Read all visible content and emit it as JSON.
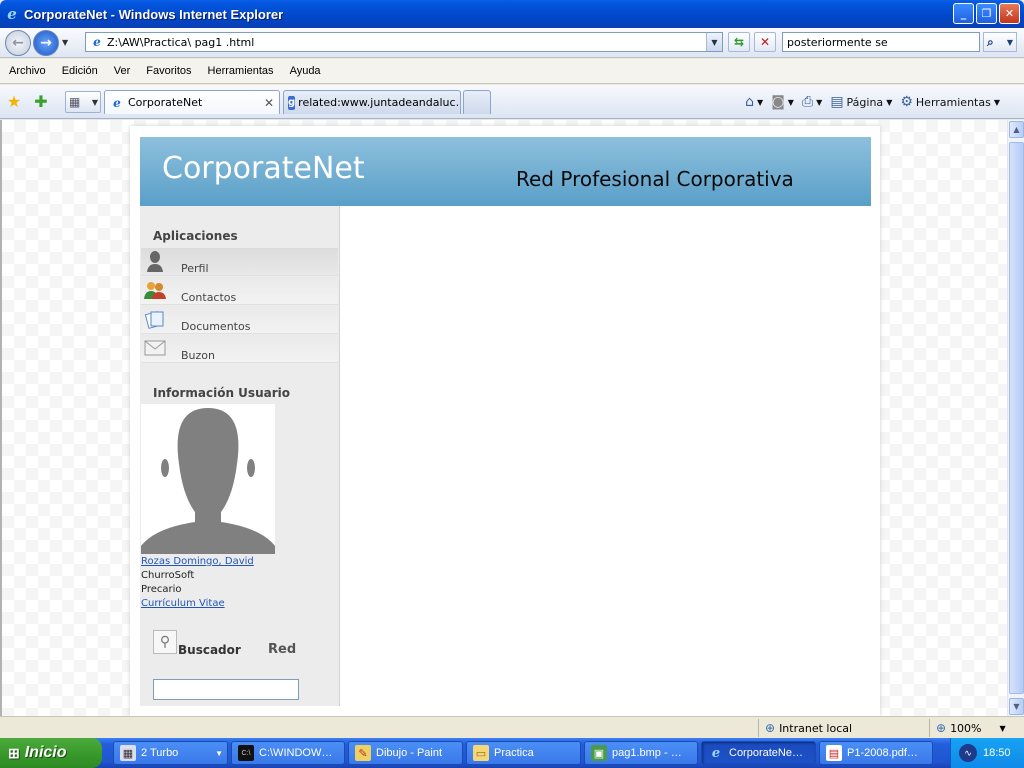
{
  "window": {
    "title": "CorporateNet - Windows Internet Explorer",
    "app_icon": "ie-logo-icon"
  },
  "addressbar": {
    "url": "Z:\\AW\\Practica\\ pag1 .html",
    "search_value": "posteriormente se"
  },
  "menu": {
    "items": [
      "Archivo",
      "Edición",
      "Ver",
      "Favoritos",
      "Herramientas",
      "Ayuda"
    ]
  },
  "tabs": [
    {
      "label": "CorporateNet",
      "active": true
    },
    {
      "label": "related:www.juntadeandaluc…",
      "active": false
    }
  ],
  "commandbar": {
    "page_label": "Página",
    "tools_label": "Herramientas"
  },
  "site": {
    "brand": "CorporateNet",
    "tagline": "Red Profesional Corporativa",
    "apps_title": "Aplicaciones",
    "apps": [
      {
        "label": "Perfil",
        "icon": "profile-icon"
      },
      {
        "label": "Contactos",
        "icon": "contacts-icon"
      },
      {
        "label": "Documentos",
        "icon": "documents-icon"
      },
      {
        "label": "Buzon",
        "icon": "mailbox-icon"
      }
    ],
    "user_title": "Información Usuario",
    "user": {
      "name": "Rozas Domingo, David",
      "company": "ChurroSoft",
      "status": "Precario",
      "cv_link": "Currículum Vitae"
    },
    "search_label": "Buscador",
    "network_label": "Red"
  },
  "status": {
    "zone": "Intranet local",
    "zoom": "100%"
  },
  "taskbar": {
    "start": "Inicio",
    "tasks": [
      {
        "label": "2 Turbo",
        "active": false
      },
      {
        "label": "C:\\WINDOW…",
        "active": false
      },
      {
        "label": "Dibujo - Paint",
        "active": false
      },
      {
        "label": "Practica",
        "active": false
      },
      {
        "label": "pag1.bmp - …",
        "active": false
      },
      {
        "label": "CorporateNe…",
        "active": true
      },
      {
        "label": "P1-2008.pdf…",
        "active": false
      }
    ],
    "clock": "18:50"
  }
}
